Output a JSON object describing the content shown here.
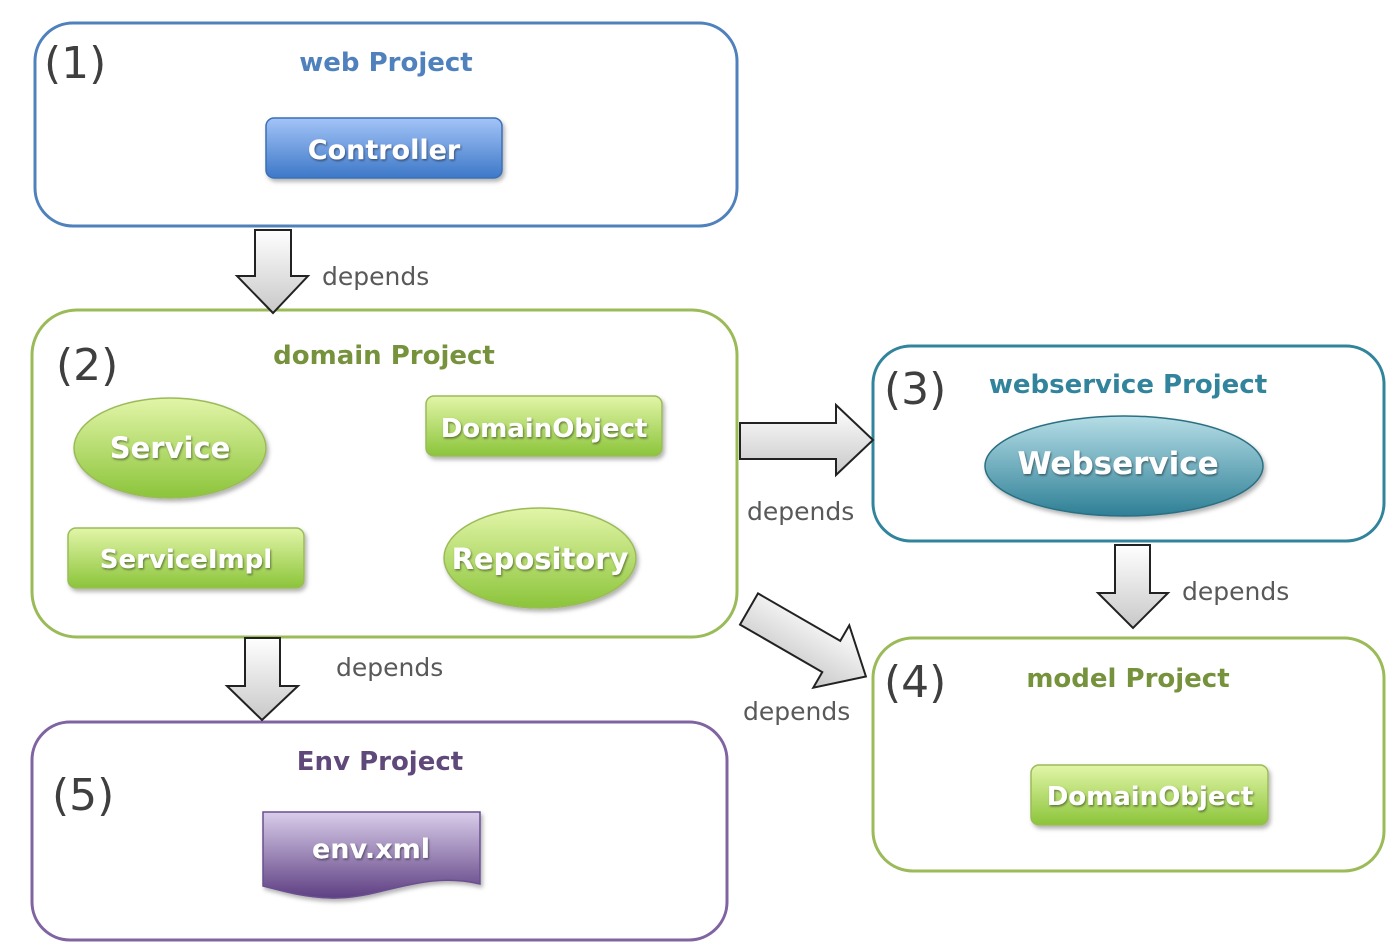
{
  "colors": {
    "web": "#4f81bd",
    "domain": "#9bbb59",
    "webservice": "#31849b",
    "model": "#9bbb59",
    "env": "#8064a2"
  },
  "projects": [
    {
      "number": "(1)",
      "title": "web Project"
    },
    {
      "number": "(2)",
      "title": "domain Project"
    },
    {
      "number": "(3)",
      "title": "webservice Project"
    },
    {
      "number": "(4)",
      "title": "model Project"
    },
    {
      "number": "(5)",
      "title": "Env Project"
    }
  ],
  "components": {
    "controller": "Controller",
    "service": "Service",
    "domain_object": "DomainObject",
    "service_impl": "ServiceImpl",
    "repository": "Repository",
    "webservice": "Webservice",
    "model_domain_object": "DomainObject",
    "env_xml": "env.xml"
  },
  "arrows": {
    "web_to_domain": "depends",
    "domain_to_env": "depends",
    "domain_to_webservice": "depends",
    "webservice_to_model": "depends",
    "domain_to_model": "depends"
  }
}
